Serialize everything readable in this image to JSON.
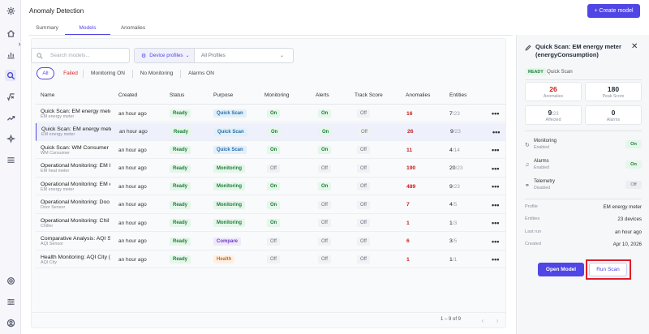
{
  "app": {
    "title": "Anomaly Detection",
    "create_button": "+ Create model"
  },
  "rail": {
    "items": [
      {
        "icon": "logo-gear-icon"
      },
      {
        "icon": "home-icon"
      },
      {
        "icon": "bar-chart-icon"
      },
      {
        "icon": "search-icon",
        "active": true
      },
      {
        "icon": "function-icon"
      },
      {
        "icon": "trend-icon"
      },
      {
        "icon": "sparkle-icon"
      },
      {
        "icon": "menu-icon"
      },
      {
        "icon": "settings-icon"
      },
      {
        "icon": "sliders-icon"
      },
      {
        "icon": "user-icon"
      }
    ],
    "collapse": "›"
  },
  "tabs": [
    "Summary",
    "Models",
    "Anomalies"
  ],
  "active_tab": "Models",
  "search": {
    "placeholder": "Search models..."
  },
  "profile_filter": {
    "type_label": "Device profiles",
    "value": "All Profiles"
  },
  "chips": [
    "All",
    "Failed",
    "Monitoring ON",
    "No Monitoring",
    "Alarms ON"
  ],
  "table": {
    "columns": [
      "Name",
      "Created",
      "Status",
      "Purpose",
      "Monitoring",
      "Alerts",
      "Track Score",
      "Anomalies",
      "Entities"
    ],
    "rows": [
      {
        "name": "Quick Scan: EM energy meter",
        "sub": "EM energy meter",
        "created": "an hour ago",
        "status": "Ready",
        "purpose": "Quick Scan",
        "purpose_kind": "qs",
        "monitoring": "On",
        "alerts": "On",
        "track": "Off",
        "anomalies": "16",
        "ent_a": "7",
        "ent_b": "/23",
        "selected": false
      },
      {
        "name": "Quick Scan: EM energy meter",
        "sub": "EM energy meter",
        "created": "an hour ago",
        "status": "Ready",
        "purpose": "Quick Scan",
        "purpose_kind": "qs",
        "monitoring": "On",
        "alerts": "On",
        "track": "Off",
        "anomalies": "26",
        "ent_a": "9",
        "ent_b": "/23",
        "selected": true
      },
      {
        "name": "Quick Scan: WM Consumer (c",
        "sub": "WM Consumer",
        "created": "an hour ago",
        "status": "Ready",
        "purpose": "Quick Scan",
        "purpose_kind": "qs",
        "monitoring": "On",
        "alerts": "On",
        "track": "Off",
        "anomalies": "11",
        "ent_a": "4",
        "ent_b": "/14",
        "selected": false
      },
      {
        "name": "Operational Monitoring: EM I",
        "sub": "EM heat meter",
        "created": "an hour ago",
        "status": "Ready",
        "purpose": "Monitoring",
        "purpose_kind": "mon",
        "monitoring": "Off",
        "alerts": "Off",
        "track": "Off",
        "anomalies": "190",
        "ent_a": "20",
        "ent_b": "/23",
        "selected": false
      },
      {
        "name": "Operational Monitoring: EM e",
        "sub": "EM energy meter",
        "created": "an hour ago",
        "status": "Ready",
        "purpose": "Monitoring",
        "purpose_kind": "mon",
        "monitoring": "On",
        "alerts": "On",
        "track": "Off",
        "anomalies": "489",
        "ent_a": "9",
        "ent_b": "/23",
        "selected": false
      },
      {
        "name": "Operational Monitoring: Doo",
        "sub": "Door Sensor",
        "created": "an hour ago",
        "status": "Ready",
        "purpose": "Monitoring",
        "purpose_kind": "mon",
        "monitoring": "On",
        "alerts": "Off",
        "track": "Off",
        "anomalies": "7",
        "ent_a": "4",
        "ent_b": "/5",
        "selected": false
      },
      {
        "name": "Operational Monitoring: Chil",
        "sub": "Chiller",
        "created": "an hour ago",
        "status": "Ready",
        "purpose": "Monitoring",
        "purpose_kind": "mon",
        "monitoring": "On",
        "alerts": "Off",
        "track": "Off",
        "anomalies": "1",
        "ent_a": "1",
        "ent_b": "/3",
        "selected": false
      },
      {
        "name": "Comparative Analysis: AQI Se",
        "sub": "AQI Sensor",
        "created": "an hour ago",
        "status": "Ready",
        "purpose": "Compare",
        "purpose_kind": "cmp",
        "monitoring": "Off",
        "alerts": "Off",
        "track": "Off",
        "anomalies": "6",
        "ent_a": "3",
        "ent_b": "/5",
        "selected": false
      },
      {
        "name": "Health Monitoring: AQI City (",
        "sub": "AQI City",
        "created": "an hour ago",
        "status": "Ready",
        "purpose": "Health",
        "purpose_kind": "hlt",
        "monitoring": "Off",
        "alerts": "Off",
        "track": "Off",
        "anomalies": "1",
        "ent_a": "1",
        "ent_b": "/1",
        "selected": false
      }
    ]
  },
  "pagination": {
    "text": "1 – 9 of 9",
    "prev": "‹",
    "next": "›"
  },
  "panel": {
    "title": "Quick Scan: EM energy meter (energyConsumption)",
    "status": "READY",
    "purpose": "Quick Scan",
    "stats": [
      {
        "value": "26",
        "suffix": "",
        "label": "Anomalies",
        "red": true
      },
      {
        "value": "180",
        "suffix": "",
        "label": "Peak Score",
        "red": false
      },
      {
        "value": "9",
        "suffix": "/23",
        "label": "Affected",
        "red": false
      },
      {
        "value": "0",
        "suffix": "",
        "label": "Alarms",
        "red": false
      }
    ],
    "toggles": [
      {
        "label": "Monitoring",
        "sub": "Enabled",
        "state": "On",
        "on": true
      },
      {
        "label": "Alarms",
        "sub": "Enabled",
        "state": "On",
        "on": true
      },
      {
        "label": "Telemetry",
        "sub": "Disabled",
        "state": "Off",
        "on": false
      }
    ],
    "meta": [
      {
        "key": "Profile",
        "value": "EM energy meter"
      },
      {
        "key": "Entities",
        "value": "23 devices"
      },
      {
        "key": "Last run",
        "value": "an hour ago"
      },
      {
        "key": "Created",
        "value": "Apr 10, 2026"
      }
    ],
    "open_button": "Open Model",
    "run_button": "Run Scan"
  },
  "colors": {
    "accent": "#4f46e5",
    "danger": "#c81e1e",
    "success": "#1e7e3a",
    "highlight": "#e11d2a"
  }
}
